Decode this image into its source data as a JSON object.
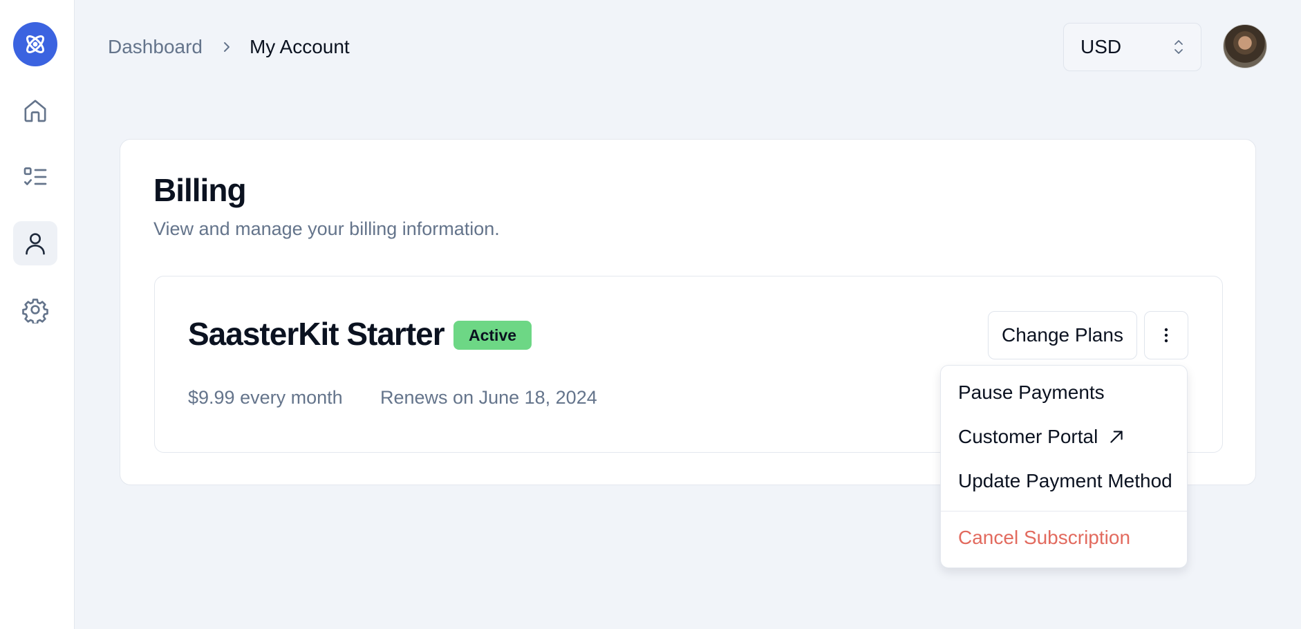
{
  "breadcrumb": {
    "parent": "Dashboard",
    "current": "My Account"
  },
  "currency": {
    "selected": "USD"
  },
  "sidebar": {
    "items": [
      {
        "name": "home",
        "icon": "home-icon",
        "active": false
      },
      {
        "name": "tasks",
        "icon": "checklist-icon",
        "active": false
      },
      {
        "name": "account",
        "icon": "user-icon",
        "active": true
      },
      {
        "name": "settings",
        "icon": "gear-icon",
        "active": false
      }
    ]
  },
  "billing": {
    "title": "Billing",
    "subtitle": "View and manage your billing information.",
    "plan": {
      "name": "SaasterKit Starter",
      "status": "Active",
      "price": "$9.99 every month",
      "renews": "Renews on June 18, 2024",
      "change_label": "Change Plans"
    }
  },
  "menu": {
    "items": [
      {
        "label": "Pause Payments"
      },
      {
        "label": "Customer Portal"
      },
      {
        "label": "Update Payment Method"
      },
      {
        "label": "Cancel Subscription"
      }
    ]
  },
  "colors": {
    "accent": "#3b63e0",
    "active_badge": "#6dd785",
    "danger": "#e26a5e",
    "background": "#f1f4f9"
  }
}
